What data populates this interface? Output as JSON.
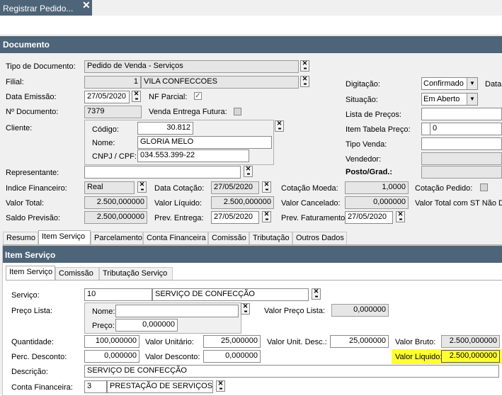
{
  "window": {
    "title": "Registrar Pedido..."
  },
  "documento": {
    "header": "Documento",
    "tipo_label": "Tipo de Documento:",
    "tipo_value": "Pedido de Venda - Serviços",
    "filial_label": "Filial:",
    "filial_code": "1",
    "filial_name": "VILA CONFECCOES",
    "data_emissao_label": "Data Emissão:",
    "data_emissao": "27/05/2020",
    "nf_parcial_label": "NF Parcial:",
    "num_doc_label": "Nº Documento:",
    "num_doc": "7379",
    "venda_entrega_label": "Venda Entrega Futura:",
    "cliente_label": "Cliente:",
    "codigo_label": "Código:",
    "codigo": "30.812",
    "nome_label": "Nome:",
    "nome": "GLORIA MELO",
    "cnpj_label": "CNPJ / CPF:",
    "cnpj": "034.553.399-22",
    "representante_label": "Representante:",
    "indice_label": "Indice Financeiro:",
    "indice": "Real",
    "data_cotacao_label": "Data Cotação:",
    "data_cotacao": "27/05/2020",
    "cotacao_moeda_label": "Cotação Moeda:",
    "cotacao_moeda": "1,0000",
    "cotacao_pedido_label": "Cotação Pedido:",
    "valor_total_label": "Valor Total:",
    "valor_total": "2.500,000000",
    "valor_liquido_label": "Valor Líquido:",
    "valor_liquido": "2.500,000000",
    "valor_cancelado_label": "Valor Cancelado:",
    "valor_cancelado": "0,000000",
    "valor_total_st_label": "Valor Total com ST Não De",
    "saldo_previsao_label": "Saldo Previsão:",
    "saldo_previsao": "2.500,000000",
    "prev_entrega_label": "Prev. Entrega:",
    "prev_entrega": "27/05/2020",
    "prev_faturamento_label": "Prev. Faturamento:",
    "prev_faturamento": "27/05/2020",
    "digitacao_label": "Digitação:",
    "digitacao": "Confirmado",
    "data_cut_label": "Data",
    "situacao_label": "Situação:",
    "situacao": "Em Aberto",
    "lista_precos_label": "Lista de Preços:",
    "item_tabela_label": "Item Tabela Preço:",
    "item_tabela": "0",
    "tipo_venda_label": "Tipo Venda:",
    "vendedor_label": "Vendedor:",
    "posto_label": "Posto/Grad.:"
  },
  "tabs": [
    "Resumo",
    "Item Serviço",
    "Parcelamento",
    "Conta Financeira",
    "Comissão",
    "Tributação",
    "Outros Dados"
  ],
  "item_servico": {
    "header": "Item Serviço",
    "subtabs": [
      "Item Serviço",
      "Comissão",
      "Tributação Serviço"
    ],
    "servico_label": "Serviço:",
    "servico_code": "10",
    "servico_name": "SERVIÇO DE CONFECÇÃO",
    "preco_lista_label": "Preço Lista:",
    "pl_nome_label": "Nome:",
    "pl_preco_label": "Preço:",
    "pl_preco": "0,000000",
    "valor_preco_lista_label": "Valor Preço Lista:",
    "valor_preco_lista": "0,000000",
    "quantidade_label": "Quantidade:",
    "quantidade": "100,000000",
    "valor_unitario_label": "Valor Unitário:",
    "valor_unitario": "25,000000",
    "valor_unit_desc_label": "Valor Unit. Desc.:",
    "valor_unit_desc": "25,000000",
    "valor_bruto_label": "Valor Bruto:",
    "valor_bruto": "2.500,000000",
    "perc_desconto_label": "Perc. Desconto:",
    "perc_desconto": "0,000000",
    "valor_desconto_label": "Valor Desconto:",
    "valor_desconto": "0,000000",
    "valor_liquido_label": "Valor Liquido:",
    "valor_liquido": "2.500,000000",
    "descricao_label": "Descrição:",
    "descricao": "SERVIÇO DE CONFECÇÃO",
    "conta_fin_label": "Conta Financeira:",
    "conta_fin_code": "3",
    "conta_fin_name": "PRESTAÇÃO DE SERVIÇOS - CO"
  },
  "icons": {
    "lookup": "lookup-button-icon",
    "close": "close-icon",
    "check": "check-icon",
    "dropdown": "chevron-down-icon"
  },
  "colors": {
    "header_bg": "#4e6478",
    "highlight": "#ffff33"
  }
}
